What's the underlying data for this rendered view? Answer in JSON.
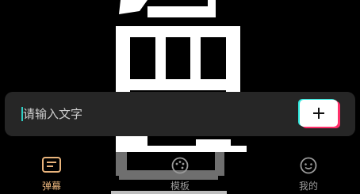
{
  "input": {
    "placeholder": "请输入文字",
    "value": ""
  },
  "add_button": {
    "icon": "plus-icon"
  },
  "tabs": [
    {
      "label": "弹幕",
      "icon": "barrage-icon",
      "active": true
    },
    {
      "label": "模板",
      "icon": "template-icon",
      "active": false
    },
    {
      "label": "我的",
      "icon": "profile-icon",
      "active": false
    }
  ],
  "colors": {
    "background": "#000000",
    "panel": "#262626",
    "active_tab": "#e9b47c",
    "inactive_tab": "#9a9a9a",
    "caret": "#2fd0c6",
    "accent_cyan": "#2fe6dc",
    "accent_pink": "#ff2f6a"
  }
}
